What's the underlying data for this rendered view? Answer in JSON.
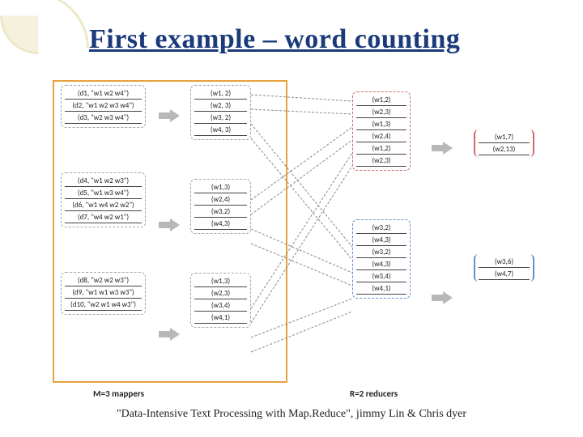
{
  "title": "First example – word counting",
  "citation": "\"Data-Intensive Text Processing with Map.Reduce\", jimmy Lin & Chris dyer",
  "caption_m": "M=3 mappers",
  "caption_r": "R=2 reducers",
  "mapper1_src": [
    "(d1, \"w1 w2 w4\")",
    "(d2, \"w1 w2 w3 w4\")",
    "(d3, \"w2 w3 w4\")"
  ],
  "mapper1_out": [
    "(w1, 2)",
    "(w2, 3)",
    "(w3, 2)",
    "(w4, 3)"
  ],
  "mapper2_src": [
    "(d4, \"w1 w2 w3\")",
    "(d5, \"w1 w3 w4\")",
    "(d6, \"w1 w4 w2 w2\")",
    "(d7, \"w4 w2 w1\")"
  ],
  "mapper2_out": [
    "(w1,3)",
    "(w2,4)",
    "(w3,2)",
    "(w4,3)"
  ],
  "mapper3_src": [
    "(d8, \"w2 w2 w3\")",
    "(d9, \"w1 w1 w3 w3\")",
    "(d10, \"w2 w1 w4 w3\")"
  ],
  "mapper3_out": [
    "(w1,3)",
    "(w2,3)",
    "(w3,4)",
    "(w4,1)"
  ],
  "reducer1_in": [
    "(w1,2)",
    "(w2,3)",
    "(w1,3)",
    "(w2,4)",
    "(w1,2)",
    "(w2,3)"
  ],
  "reducer2_in": [
    "(w3,2)",
    "(w4,3)",
    "(w3,2)",
    "(w4,3)",
    "(w3,4)",
    "(w4,1)"
  ],
  "out1": [
    "(w1,7)",
    "(w2,13)"
  ],
  "out2": [
    "(w3,6)",
    "(w4,7)"
  ]
}
